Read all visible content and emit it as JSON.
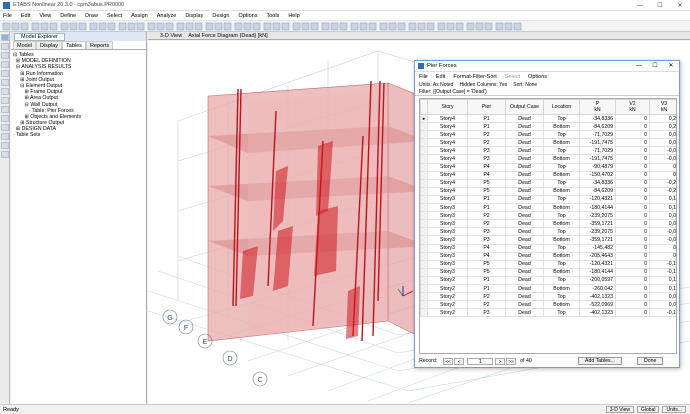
{
  "app": {
    "title": "ETABS Nonlinear 20.3.0 - cpm3abus.PR0000",
    "minimize": "—",
    "maximize": "☐",
    "close": "✕"
  },
  "menu": [
    "File",
    "Edit",
    "View",
    "Define",
    "Draw",
    "Select",
    "Assign",
    "Analyze",
    "Display",
    "Design",
    "Options",
    "Tools",
    "Help"
  ],
  "explorer": {
    "title": "Model Explorer",
    "tabs": [
      "Model",
      "Display",
      "Tables",
      "Reports"
    ],
    "tree": [
      "⊟ Tables",
      "  ⊞ MODEL DEFINITION",
      "  ⊟ ANALYSIS RESULTS",
      "     ⊞ Run Information",
      "     ⊞ Joint Output",
      "     ⊟ Element Output",
      "        ⊞ Frame Output",
      "        ⊞ Area Output",
      "        ⊟ Wall Output",
      "           · Table: Pier Forces",
      "        ⊞ Objects and Elements",
      "     ⊞ Structure Output",
      "  ⊞ DESIGN DATA",
      "· Table Sets"
    ]
  },
  "view_tabs": [
    "3-D View",
    "Axial Force Diagram (Dead) [kN]"
  ],
  "status": {
    "left": "Ready",
    "right": [
      "3-D View",
      "Global",
      "Units..."
    ]
  },
  "dialog": {
    "title": "Pier Forces",
    "menu": [
      "File",
      "Edit",
      "Format-Filter-Sort",
      "Select",
      "Options"
    ],
    "info": [
      "Units: As Noted",
      "Hidden Columns: Yes",
      "Sort: None"
    ],
    "filter": "Filter: ([Output Case] = 'Dead')",
    "columns": [
      {
        "name": "Story",
        "unit": ""
      },
      {
        "name": "Pier",
        "unit": ""
      },
      {
        "name": "Output Case",
        "unit": ""
      },
      {
        "name": "Location",
        "unit": ""
      },
      {
        "name": "P",
        "unit": "kN"
      },
      {
        "name": "V2",
        "unit": "kN"
      },
      {
        "name": "V3",
        "unit": "kN"
      }
    ],
    "rows": [
      [
        "Story4",
        "P1",
        "Dead",
        "Top",
        "-34,8336",
        "0",
        "0,2"
      ],
      [
        "Story4",
        "P1",
        "Dead",
        "Bottom",
        "-84,6209",
        "0",
        "0,2"
      ],
      [
        "Story4",
        "P2",
        "Dead",
        "Top",
        "-71,7029",
        "0",
        "0,0"
      ],
      [
        "Story4",
        "P2",
        "Dead",
        "Bottom",
        "-191,7475",
        "0",
        "0,0"
      ],
      [
        "Story4",
        "P3",
        "Dead",
        "Top",
        "-71,7029",
        "0",
        "-0,0"
      ],
      [
        "Story4",
        "P3",
        "Dead",
        "Bottom",
        "-191,7475",
        "0",
        "-0,0"
      ],
      [
        "Story4",
        "P4",
        "Dead",
        "Top",
        "-90,4879",
        "0",
        "0"
      ],
      [
        "Story4",
        "P4",
        "Dead",
        "Bottom",
        "-150,4702",
        "0",
        "0"
      ],
      [
        "Story4",
        "P5",
        "Dead",
        "Top",
        "-34,8336",
        "0",
        "-0,2"
      ],
      [
        "Story4",
        "P5",
        "Dead",
        "Bottom",
        "-84,6209",
        "0",
        "-0,2"
      ],
      [
        "Story3",
        "P1",
        "Dead",
        "Top",
        "-120,4321",
        "0",
        "0,1"
      ],
      [
        "Story3",
        "P1",
        "Dead",
        "Bottom",
        "-180,4144",
        "0",
        "0,1"
      ],
      [
        "Story3",
        "P2",
        "Dead",
        "Top",
        "-239,2075",
        "0",
        "0,0"
      ],
      [
        "Story3",
        "P2",
        "Dead",
        "Bottom",
        "-359,1721",
        "0",
        "0,0"
      ],
      [
        "Story3",
        "P3",
        "Dead",
        "Top",
        "-239,2075",
        "0",
        "-0,0"
      ],
      [
        "Story3",
        "P3",
        "Dead",
        "Bottom",
        "-359,1721",
        "0",
        "-0,0"
      ],
      [
        "Story3",
        "P4",
        "Dead",
        "Top",
        "-145,482",
        "0",
        "0"
      ],
      [
        "Story3",
        "P4",
        "Dead",
        "Bottom",
        "-205,4643",
        "0",
        "0"
      ],
      [
        "Story3",
        "P5",
        "Dead",
        "Top",
        "-120,4321",
        "0",
        "-0,1"
      ],
      [
        "Story3",
        "P5",
        "Dead",
        "Bottom",
        "-180,4144",
        "0",
        "-0,1"
      ],
      [
        "Story2",
        "P1",
        "Dead",
        "Top",
        "-200,0597",
        "0",
        "0,1"
      ],
      [
        "Story2",
        "P1",
        "Dead",
        "Bottom",
        "-260,042",
        "0",
        "0,1"
      ],
      [
        "Story2",
        "P2",
        "Dead",
        "Top",
        "-402,1323",
        "0",
        "0,0"
      ],
      [
        "Story2",
        "P2",
        "Dead",
        "Bottom",
        "-522,0969",
        "0",
        "0,0"
      ],
      [
        "Story2",
        "P3",
        "Dead",
        "Top",
        "-402,1323",
        "0",
        "-0,1"
      ]
    ],
    "record_label": "Record:",
    "record_value": "1",
    "record_total": "of 40",
    "nav": [
      "<<",
      "<",
      ">",
      ">>"
    ],
    "add_tables": "Add Tables...",
    "done": "Done"
  },
  "grid_labels": [
    "C",
    "D",
    "E",
    "F",
    "G"
  ]
}
